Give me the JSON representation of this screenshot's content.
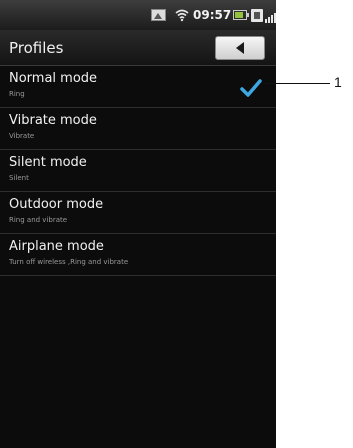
{
  "status_bar": {
    "time": "09:57",
    "icons": [
      "gallery-icon",
      "wifi-icon",
      "battery-icon",
      "data-icon",
      "signal-icon"
    ]
  },
  "header": {
    "title": "Profiles",
    "back_icon": "back-arrow-icon"
  },
  "profiles": [
    {
      "label": "Normal mode",
      "description": "Ring",
      "selected": true
    },
    {
      "label": "Vibrate mode",
      "description": "Vibrate",
      "selected": false
    },
    {
      "label": "Silent mode",
      "description": "Silent",
      "selected": false
    },
    {
      "label": "Outdoor mode",
      "description": "Ring and vibrate",
      "selected": false
    },
    {
      "label": "Airplane mode",
      "description": "Turn off wireless ,Ring and vibrate",
      "selected": false
    }
  ],
  "callout": {
    "number": "1"
  },
  "colors": {
    "check": "#3ea6e0",
    "background": "#0c0c0c"
  }
}
